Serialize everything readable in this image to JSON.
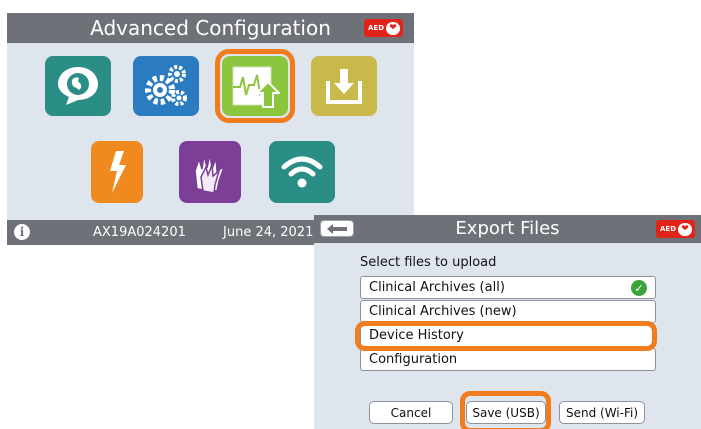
{
  "colors": {
    "screen_bg": "#dee5ec",
    "bar_bg": "#6e7178",
    "highlight": "#f07c1e",
    "aed_red": "#e2231a",
    "check_green": "#3ba53b"
  },
  "main_screen": {
    "title": "Advanced Configuration",
    "aed_badge": "AED",
    "tiles": [
      {
        "icon": "language-speech-icon",
        "color": "#2a8d86"
      },
      {
        "icon": "settings-gears-icon",
        "color": "#2a7bc0"
      },
      {
        "icon": "export-ecg-upload-icon",
        "color": "#8cc63f",
        "selected": true
      },
      {
        "icon": "download-icon",
        "color": "#c9b84a"
      },
      {
        "icon": "shock-lightning-icon",
        "color": "#f08a1e"
      },
      {
        "icon": "cpr-hands-icon",
        "color": "#7b3f98"
      },
      {
        "icon": "wifi-icon",
        "color": "#2a8d86"
      }
    ],
    "footer": {
      "info_icon": "i",
      "serial": "AX19A024201",
      "date": "June 24, 2021"
    }
  },
  "export_screen": {
    "title": "Export Files",
    "aed_badge": "AED",
    "back_icon": "back-arrow-icon",
    "prompt": "Select files to upload",
    "files": [
      {
        "label": "Clinical Archives (all)",
        "checked": true
      },
      {
        "label": "Clinical Archives (new)",
        "checked": false
      },
      {
        "label": "Device History",
        "checked": false,
        "highlighted": true
      },
      {
        "label": "Configuration",
        "checked": false
      }
    ],
    "check_mark": "✓",
    "buttons": {
      "cancel": "Cancel",
      "save_usb": "Save (USB)",
      "send_wifi": "Send (Wi-Fi)"
    }
  }
}
